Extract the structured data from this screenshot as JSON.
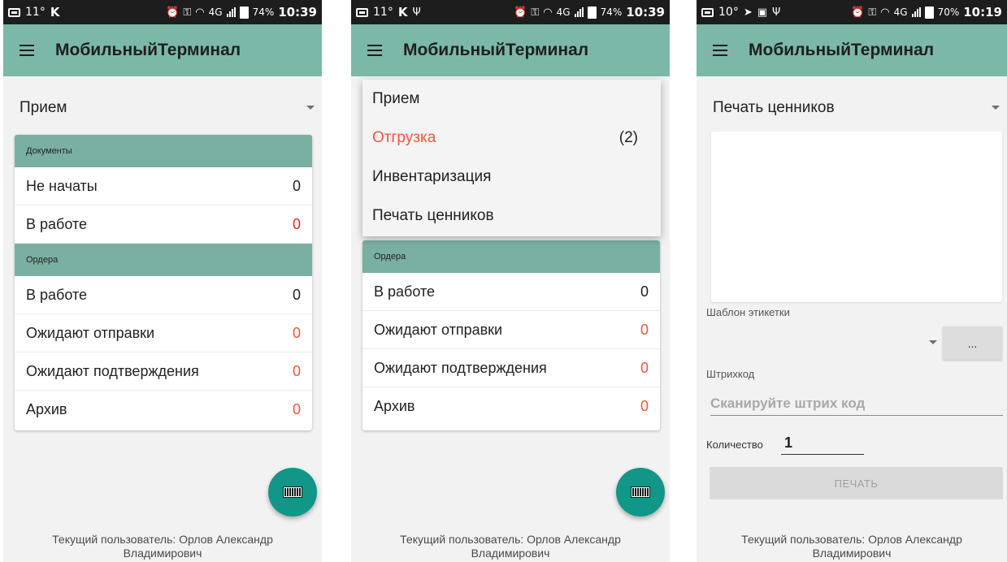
{
  "app": {
    "title": "МобильныйТерминал"
  },
  "screens": [
    {
      "status": {
        "temp": "11°",
        "battery": "74%",
        "time": "10:39",
        "network": "4G"
      },
      "selector": "Прием",
      "sections": [
        {
          "title": "Документы",
          "rows": [
            {
              "label": "Не начаты",
              "count": "0",
              "color": "normal"
            },
            {
              "label": "В работе",
              "count": "0",
              "color": "red"
            }
          ]
        },
        {
          "title": "Ордера",
          "rows": [
            {
              "label": "В работе",
              "count": "0",
              "color": "normal"
            },
            {
              "label": "Ожидают отправки",
              "count": "0",
              "color": "orange"
            },
            {
              "label": "Ожидают подтверждения",
              "count": "0",
              "color": "orange"
            },
            {
              "label": "Архив",
              "count": "0",
              "color": "orange"
            }
          ]
        }
      ],
      "footer": "Текущий пользователь: Орлов Александр Владимирович"
    },
    {
      "status": {
        "temp": "11°",
        "battery": "74%",
        "time": "10:39",
        "network": "4G"
      },
      "menu": [
        {
          "label": "Прием",
          "count": ""
        },
        {
          "label": "Отгрузка",
          "count": "(2)"
        },
        {
          "label": "Инвентаризация",
          "count": ""
        },
        {
          "label": "Печать ценников",
          "count": ""
        }
      ],
      "sections": [
        {
          "title": "Ордера",
          "rows": [
            {
              "label": "В работе",
              "count": "0",
              "color": "normal"
            },
            {
              "label": "Ожидают отправки",
              "count": "0",
              "color": "orange"
            },
            {
              "label": "Ожидают подтверждения",
              "count": "0",
              "color": "orange"
            },
            {
              "label": "Архив",
              "count": "0",
              "color": "orange"
            }
          ]
        }
      ],
      "footer": "Текущий пользователь: Орлов Александр Владимирович"
    },
    {
      "status": {
        "temp": "10°",
        "battery": "70%",
        "time": "10:19",
        "network": "4G"
      },
      "selector": "Печать ценников",
      "template_label": "Шаблон этикетки",
      "dots_label": "...",
      "barcode_label": "Штрихкод",
      "barcode_placeholder": "Сканируйте штрих код",
      "quantity_label": "Количество",
      "quantity_value": "1",
      "print_label": "ПЕЧАТЬ",
      "footer": "Текущий пользователь: Орлов Александр Владимирович"
    }
  ],
  "colors": {
    "appbar": "#7cb8a7",
    "section_header": "#79b0a1",
    "fab": "#119688",
    "orange": "#f1553a",
    "red": "#d32f2f"
  },
  "icons": [
    "menu-icon",
    "dropdown-arrow-icon",
    "barcode-icon",
    "alarm-icon",
    "key-icon",
    "wifi-icon",
    "battery-icon"
  ]
}
